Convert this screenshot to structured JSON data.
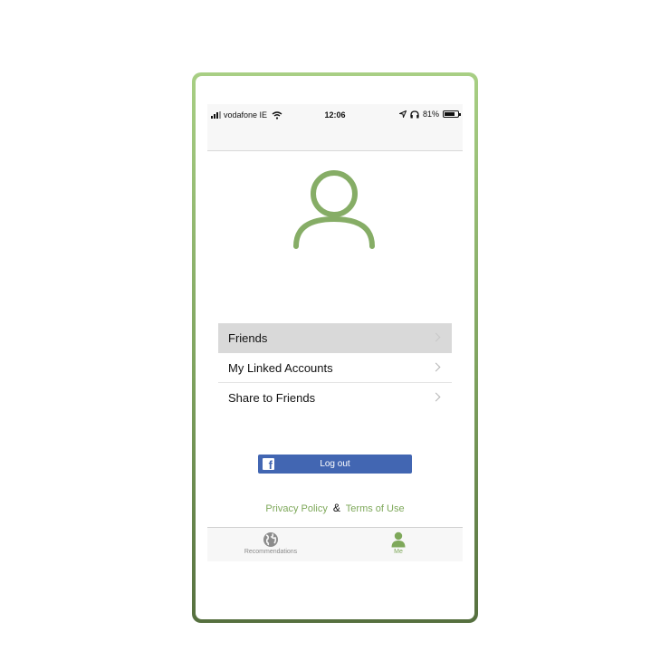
{
  "status_bar": {
    "carrier": "vodafone IE",
    "time": "12:06",
    "battery_percent": "81%",
    "battery_level": 0.81
  },
  "profile": {
    "avatar_icon": "user-outline-icon",
    "avatar_color": "#86ad66"
  },
  "menu": {
    "items": [
      {
        "label": "Friends",
        "selected": true
      },
      {
        "label": "My Linked Accounts",
        "selected": false
      },
      {
        "label": "Share to Friends",
        "selected": false
      }
    ]
  },
  "logout": {
    "label": "Log out",
    "icon": "facebook-icon",
    "color": "#4266b2"
  },
  "legal": {
    "privacy": "Privacy Policy",
    "separator": "&",
    "terms": "Terms of Use",
    "link_color": "#7ea85a"
  },
  "tab_bar": {
    "tabs": [
      {
        "label": "Recommendations",
        "icon": "globe-icon",
        "active": false
      },
      {
        "label": "Me",
        "icon": "person-icon",
        "active": true
      }
    ]
  }
}
